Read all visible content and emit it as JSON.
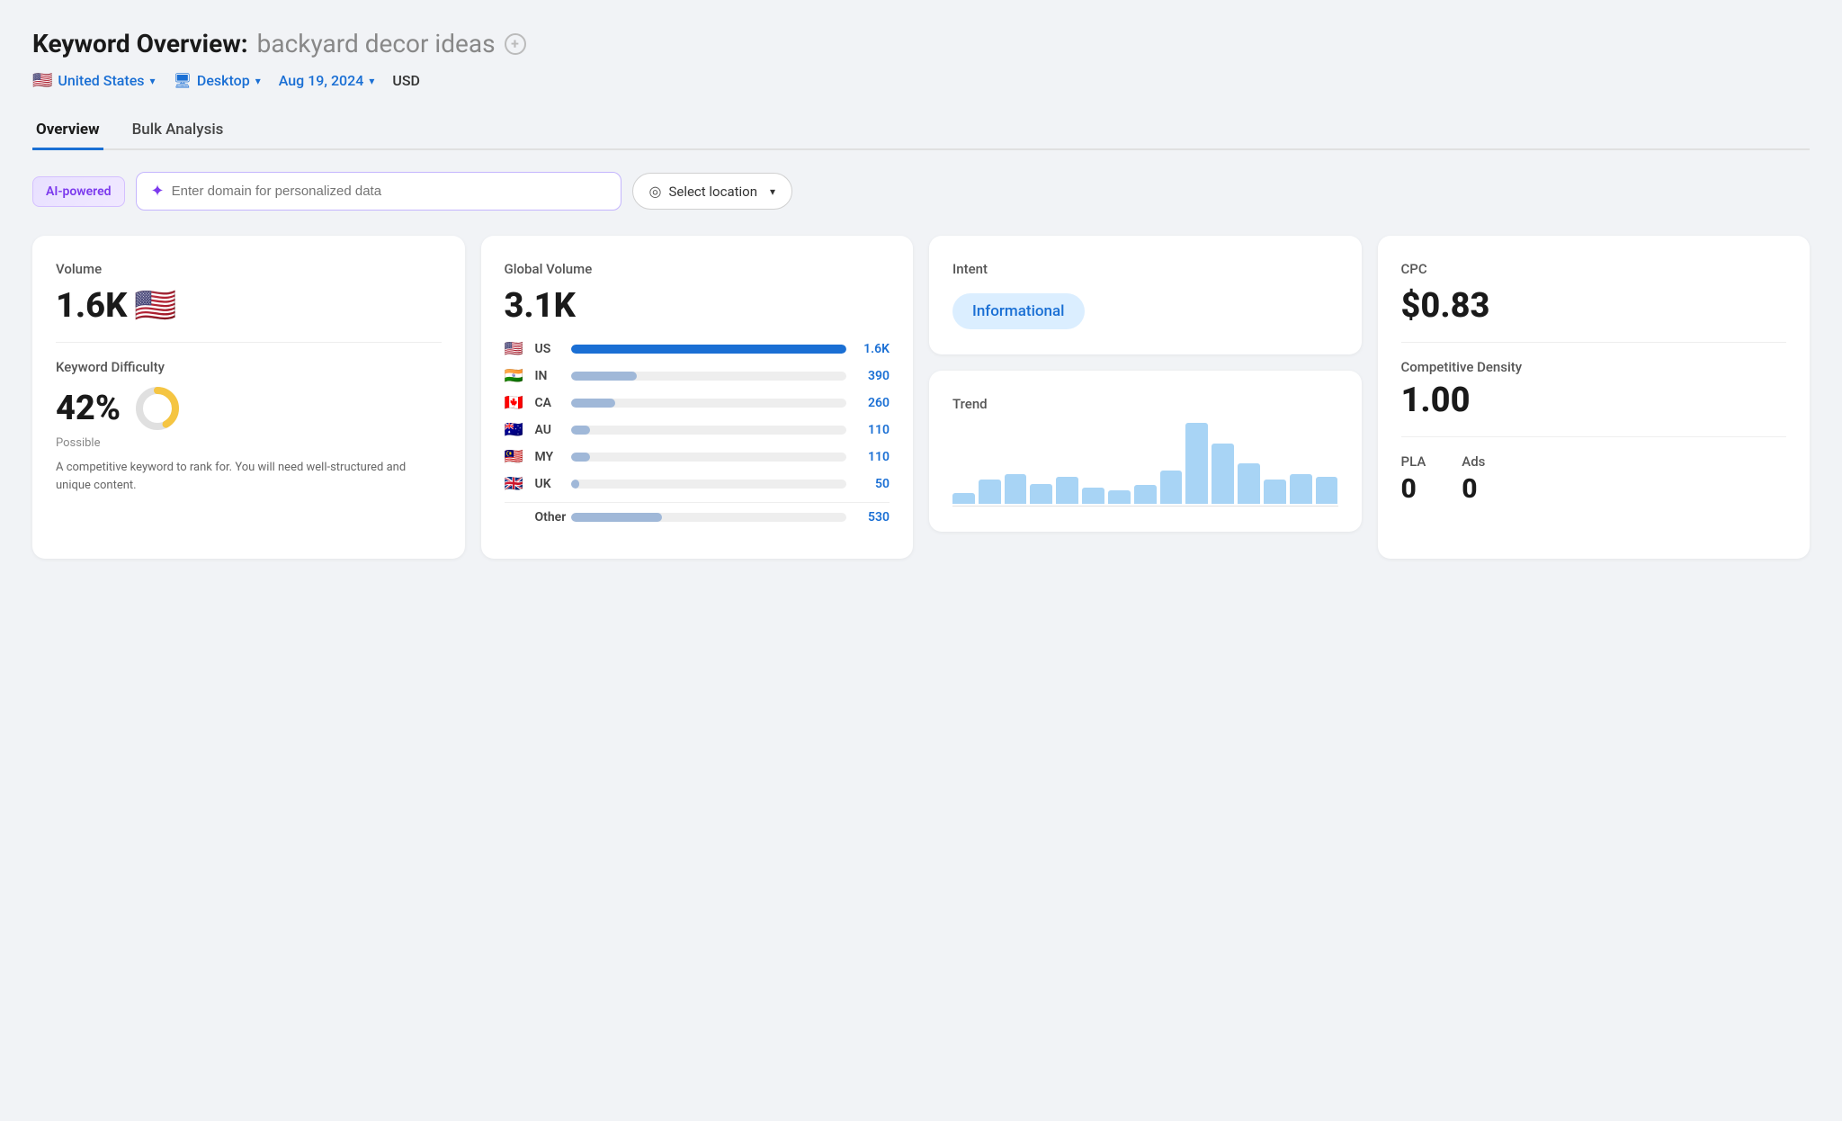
{
  "page": {
    "title_prefix": "Keyword Overview:",
    "title_keyword": "backyard decor ideas",
    "filters": {
      "country": "United States",
      "country_flag": "🇺🇸",
      "device": "Desktop",
      "date": "Aug 19, 2024",
      "currency": "USD"
    },
    "tabs": [
      {
        "label": "Overview",
        "active": true
      },
      {
        "label": "Bulk Analysis",
        "active": false
      }
    ],
    "ai_badge": "AI-powered",
    "domain_placeholder": "Enter domain for personalized data",
    "select_location": "Select location"
  },
  "cards": {
    "volume": {
      "label": "Volume",
      "value": "1.6K",
      "flag": "🇺🇸"
    },
    "keyword_difficulty": {
      "label": "Keyword Difficulty",
      "value": "42%",
      "possible_label": "Possible",
      "donut_pct": 42,
      "description": "A competitive keyword to rank for. You will need well-structured and unique content.",
      "donut_yellow": "#f5c542",
      "donut_gray": "#e0e0e0"
    },
    "global_volume": {
      "label": "Global Volume",
      "value": "3.1K",
      "rows": [
        {
          "flag": "🇺🇸",
          "code": "US",
          "value": "1.6K",
          "pct": 100,
          "color": "#1a6fd4"
        },
        {
          "flag": "🇮🇳",
          "code": "IN",
          "value": "390",
          "pct": 24,
          "color": "#a0b8d8"
        },
        {
          "flag": "🇨🇦",
          "code": "CA",
          "value": "260",
          "pct": 16,
          "color": "#a0b8d8"
        },
        {
          "flag": "🇦🇺",
          "code": "AU",
          "value": "110",
          "pct": 7,
          "color": "#a0b8d8"
        },
        {
          "flag": "🇲🇾",
          "code": "MY",
          "value": "110",
          "pct": 7,
          "color": "#a0b8d8"
        },
        {
          "flag": "🇬🇧",
          "code": "UK",
          "value": "50",
          "pct": 3,
          "color": "#a0b8d8"
        }
      ],
      "other_label": "Other",
      "other_value": "530",
      "other_pct": 33,
      "other_color": "#a0b8d8"
    },
    "intent": {
      "label": "Intent",
      "value": "Informational"
    },
    "trend": {
      "label": "Trend",
      "bars": [
        8,
        18,
        22,
        15,
        20,
        12,
        10,
        14,
        25,
        60,
        45,
        30,
        18,
        22,
        20
      ]
    },
    "cpc": {
      "label": "CPC",
      "value": "$0.83"
    },
    "competitive_density": {
      "label": "Competitive Density",
      "value": "1.00"
    },
    "pla": {
      "label": "PLA",
      "value": "0"
    },
    "ads": {
      "label": "Ads",
      "value": "0"
    }
  }
}
